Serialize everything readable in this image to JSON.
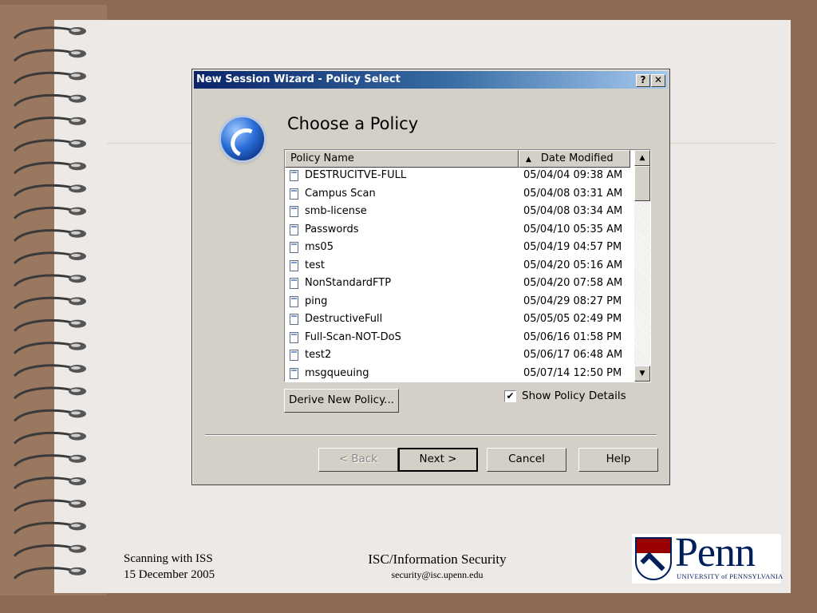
{
  "dialog": {
    "title": "New Session Wizard - Policy Select",
    "help_btn": "?",
    "close_btn": "✕",
    "heading": "Choose a Policy",
    "list": {
      "columns": [
        "Policy Name",
        "Date Modified"
      ],
      "sort_indicator": "▲",
      "rows": [
        {
          "name": "DESTRUCITVE-FULL",
          "date": "05/04/04 09:38 AM"
        },
        {
          "name": "Campus Scan",
          "date": "05/04/08 03:31 AM"
        },
        {
          "name": "smb-license",
          "date": "05/04/08 03:34 AM"
        },
        {
          "name": "Passwords",
          "date": "05/04/10 05:35 AM"
        },
        {
          "name": "ms05",
          "date": "05/04/19 04:57 PM"
        },
        {
          "name": "test",
          "date": "05/04/20 05:16 AM"
        },
        {
          "name": "NonStandardFTP",
          "date": "05/04/20 07:58 AM"
        },
        {
          "name": "ping",
          "date": "05/04/29 08:27 PM"
        },
        {
          "name": "DestructiveFull",
          "date": "05/05/05 02:49 PM"
        },
        {
          "name": "Full-Scan-NOT-DoS",
          "date": "05/06/16 01:58 PM"
        },
        {
          "name": "test2",
          "date": "05/06/17 06:48 AM"
        },
        {
          "name": "msgqueuing",
          "date": "05/07/14 12:50 PM"
        }
      ],
      "scroll_up": "▲",
      "scroll_down": "▼"
    },
    "derive_button": "Derive New Policy...",
    "show_details": {
      "label": "Show Policy Details",
      "checked": "✔"
    },
    "buttons": {
      "back": "< Back",
      "next": "Next >",
      "cancel": "Cancel",
      "help": "Help"
    }
  },
  "footer": {
    "left_line1": "Scanning with ISS",
    "left_line2": "15 December 2005",
    "center_line1": "ISC/Information Security",
    "center_line2": "security@isc.upenn.edu"
  },
  "logo": {
    "word": "Penn",
    "subtitle": "UNIVERSITY of PENNSYLVANIA"
  },
  "colors": {
    "frame": "#8d6a52",
    "paper": "#ece9e6",
    "title_blue": "#0a246a",
    "penn_blue": "#011f5b",
    "penn_red": "#990000"
  }
}
